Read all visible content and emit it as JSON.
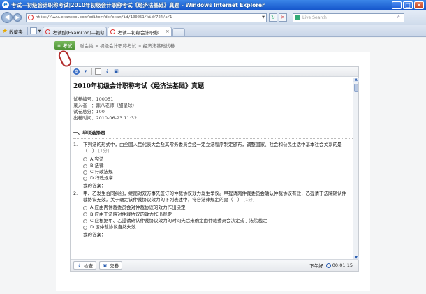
{
  "window": {
    "title": "考试—初级会计职称考试|2010年初级会计职称考试《经济法基础》真题 - Windows Internet Explorer",
    "min_label": "_",
    "max_label": "□",
    "close_label": "✕"
  },
  "address": {
    "url": "http://www.examcoo.com/editor/do/exam/id/100051/kid/724/a/1",
    "search_placeholder": "Live Search"
  },
  "favorites": {
    "label": "收藏夹"
  },
  "tabs": [
    {
      "label": "考试酷(ExamCoo)—初级会…",
      "close": ""
    },
    {
      "label": "考试—初级会计职称…",
      "close": "✕"
    }
  ],
  "breadcrumb": {
    "tag": "考试",
    "path": "财会类 > 初级会计职称考试 > 经济法基础试卷"
  },
  "paper": {
    "title": "2010年初级会计职称考试《经济法基础》真题",
    "meta": [
      "试卷编号：100051",
      "录入者　：鼎八老师（甜星球）",
      "试卷总分：100",
      "出卷时间：2010-06-23 11:32"
    ],
    "section_title": "一、单项选择题",
    "answer_label": "我的答案：",
    "questions": [
      {
        "num": "1.",
        "text": "下列法的形式中，由全国人民代表大会及其常务委员会经一定立法程序制定颁布，调整国家、社会和公民生活中基本社会关系的是（　）",
        "score": "[1分]",
        "options": [
          "A 宪法",
          "B 法律",
          "C 行政法规",
          "D 行政规章"
        ]
      },
      {
        "num": "2.",
        "text": "甲、乙发生合同纠纷，继而对双方事先签订的仲裁协议效力发生争议。甲提请丙仲裁委员会确认仲裁协议有效，乙提请丁法院确认仲裁协议无效。关于确定该仲裁协议效力的下列表述中，符合法律规定的是（　）",
        "score": "[1分]",
        "options": [
          "A 应由丙仲裁委员会对仲裁协议的效力作出决定",
          "B 应由丁法院对仲裁协议的效力作出裁定",
          "C 应根据甲、乙提请确认仲裁协议效力的时间先后来确定由仲裁委员会决定或丁法院裁定",
          "D 该仲裁协议自然失效"
        ]
      }
    ]
  },
  "footer": {
    "check_label": "检查",
    "submit_label": "交卷",
    "status": "下午好",
    "timer": "00:01:15"
  }
}
